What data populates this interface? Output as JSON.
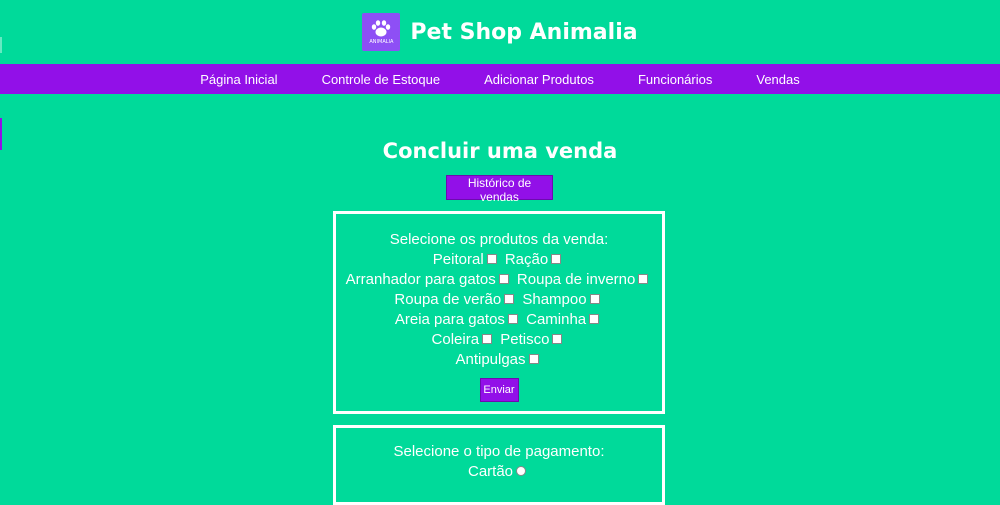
{
  "header": {
    "title": "Pet Shop Animalia",
    "logo_text": "ANIMALIA"
  },
  "nav": {
    "items": [
      "Página Inicial",
      "Controle de Estoque",
      "Adicionar Produtos",
      "Funcionários",
      "Vendas"
    ]
  },
  "main": {
    "title": "Concluir uma venda",
    "history_button": "Histórico de vendas",
    "products": {
      "prompt": "Selecione os produtos da venda:",
      "rows": [
        [
          "Peitoral",
          "Ração"
        ],
        [
          "Arranhador para gatos",
          "Roupa de inverno"
        ],
        [
          "Roupa de verão",
          "Shampoo"
        ],
        [
          "Areia para gatos",
          "Caminha"
        ],
        [
          "Coleira",
          "Petisco"
        ],
        [
          "Antipulgas"
        ]
      ],
      "submit_label": "Enviar"
    },
    "payment": {
      "prompt": "Selecione o tipo de pagamento:",
      "options": [
        "Cartão"
      ]
    }
  },
  "colors": {
    "background": "#00da9a",
    "accent": "#9210e8",
    "logo": "#8e4ff5"
  }
}
